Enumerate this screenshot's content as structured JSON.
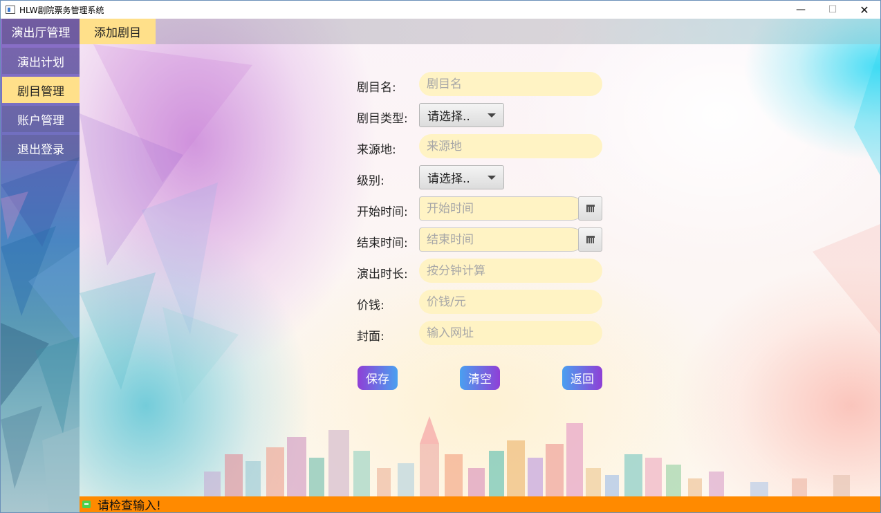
{
  "window": {
    "title": "HLW剧院票务管理系统",
    "minimize_glyph": "—",
    "maximize_glyph": "☐",
    "close_glyph": "✕"
  },
  "nav": {
    "hall": "演出厅管理",
    "plan": "演出计划",
    "play": "剧目管理",
    "account": "账户管理",
    "logout": "退出登录",
    "active": "剧目管理"
  },
  "tab": {
    "label": "添加剧目"
  },
  "form": {
    "name": {
      "label": "剧目名:",
      "placeholder": "剧目名"
    },
    "type": {
      "label": "剧目类型:",
      "value": "请选择.."
    },
    "origin": {
      "label": "来源地:",
      "placeholder": "来源地"
    },
    "level": {
      "label": "级别:",
      "value": "请选择.."
    },
    "start": {
      "label": "开始时间:",
      "placeholder": "开始时间"
    },
    "end": {
      "label": "结束时间:",
      "placeholder": "结束时间"
    },
    "duration": {
      "label": "演出时长:",
      "placeholder": "按分钟计算"
    },
    "price": {
      "label": "价钱:",
      "placeholder": "价钱/元"
    },
    "cover": {
      "label": "封面:",
      "placeholder": "输入网址"
    }
  },
  "buttons": {
    "save": "保存",
    "clear": "清空",
    "back": "返回"
  },
  "status": {
    "message": "请检查输入!"
  },
  "colors": {
    "highlight": "#ffe08a",
    "field_bg": "#fff3c4",
    "status_bar": "#ff8a00",
    "button_purple": "#8f3fd6",
    "button_blue": "#4aa0f0"
  },
  "icons": [
    "app-icon",
    "calendar-icon",
    "dropdown-arrow-icon",
    "status-message-icon"
  ]
}
